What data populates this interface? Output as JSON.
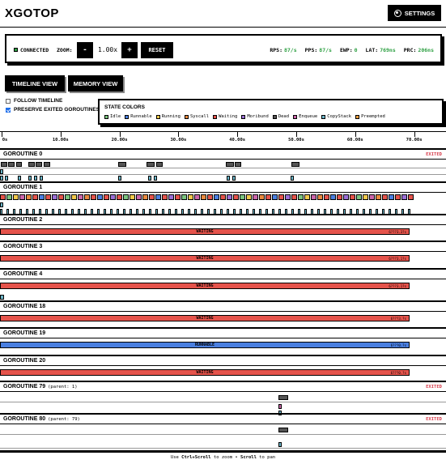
{
  "app": {
    "title": "XGOTOP",
    "settings_label": "SETTINGS"
  },
  "status": {
    "connection": "CONNECTED",
    "zoom_label": "ZOOM:",
    "zoom_minus": "-",
    "zoom_value": "1.00x",
    "zoom_plus": "+",
    "reset_label": "RESET",
    "stats": [
      {
        "label": "RPS:",
        "value": "87/s"
      },
      {
        "label": "PPS:",
        "value": "87/s"
      },
      {
        "label": "EWP:",
        "value": "0"
      },
      {
        "label": "LAT:",
        "value": "769ns"
      },
      {
        "label": "PRC:",
        "value": "206ns"
      }
    ]
  },
  "views": {
    "timeline": "TIMELINE VIEW",
    "memory": "MEMORY VIEW"
  },
  "options": {
    "follow": {
      "label": "FOLLOW TIMELINE",
      "checked": false
    },
    "preserve": {
      "label": "PRESERVE EXITED GOROUTINES",
      "checked": true
    }
  },
  "legend": {
    "title": "STATE COLORS",
    "items": [
      {
        "label": "Idle",
        "color": "#7bc47f"
      },
      {
        "label": "Runnable",
        "color": "#4a7fe0"
      },
      {
        "label": "Running",
        "color": "#f2c94c"
      },
      {
        "label": "Syscall",
        "color": "#e98a3f"
      },
      {
        "label": "Waiting",
        "color": "#e5534b"
      },
      {
        "label": "Moribund",
        "color": "#9b6fd6"
      },
      {
        "label": "Dead",
        "color": "#555555"
      },
      {
        "label": "Enqueue",
        "color": "#cc66aa"
      },
      {
        "label": "CopyStack",
        "color": "#6cb6c9"
      },
      {
        "label": "Preempted",
        "color": "#f0a040"
      }
    ]
  },
  "ruler": {
    "ticks": [
      "0s",
      "10.00s",
      "20.00s",
      "30.00s",
      "40.00s",
      "50.00s",
      "60.00s",
      "70.00s"
    ]
  },
  "goroutines": [
    {
      "title": "GOROUTINE 0",
      "parent": "",
      "exited": "EXITED"
    },
    {
      "title": "GOROUTINE 1",
      "parent": "",
      "exited": ""
    },
    {
      "title": "GOROUTINE 2",
      "parent": "",
      "exited": "",
      "state": "WAITING",
      "duration": "6???3.3?s"
    },
    {
      "title": "GOROUTINE 3",
      "parent": "",
      "exited": "",
      "state": "WAITING",
      "duration": "6???3.1?s"
    },
    {
      "title": "GOROUTINE 4",
      "parent": "",
      "exited": "",
      "state": "WAITING",
      "duration": "6???3.1?s"
    },
    {
      "title": "GOROUTINE 18",
      "parent": "",
      "exited": "",
      "state": "WAITING",
      "duration": "6???3.?s"
    },
    {
      "title": "GOROUTINE 19",
      "parent": "",
      "exited": "",
      "state": "RUNNABLE",
      "duration": "6???0.?s"
    },
    {
      "title": "GOROUTINE 20",
      "parent": "",
      "exited": "",
      "state": "WAITING",
      "duration": "6???0.?s"
    },
    {
      "title": "GOROUTINE 79",
      "parent": "(parent: 1)",
      "exited": "EXITED"
    },
    {
      "title": "GOROUTINE 80",
      "parent": "(parent: 79)",
      "exited": "EXITED"
    }
  ],
  "footer": {
    "pre": "Use ",
    "k1": "Ctrl+Scroll",
    "mid": " to zoom • ",
    "k2": "Scroll",
    "post": " to pan"
  }
}
